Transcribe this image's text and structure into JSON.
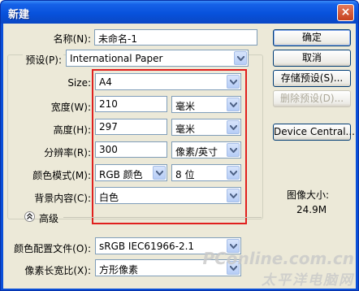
{
  "window": {
    "title": "新建",
    "close_glyph": "×"
  },
  "form": {
    "name_label": "名称(N):",
    "name_value": "未命名-1",
    "preset_label": "预设(P):",
    "preset_value": "International Paper",
    "size_label": "Size:",
    "size_value": "A4",
    "width_label": "宽度(W):",
    "width_value": "210",
    "width_unit": "毫米",
    "height_label": "高度(H):",
    "height_value": "297",
    "height_unit": "毫米",
    "resolution_label": "分辨率(R):",
    "resolution_value": "300",
    "resolution_unit": "像素/英寸",
    "mode_label": "颜色模式(M):",
    "mode_value": "RGB 颜色",
    "bits_value": "8 位",
    "bg_label": "背景内容(C):",
    "bg_value": "白色",
    "advanced_label": "高级",
    "profile_label": "颜色配置文件(O):",
    "profile_value": "sRGB IEC61966-2.1",
    "aspect_label": "像素长宽比(X):",
    "aspect_value": "方形像素"
  },
  "buttons": {
    "ok": "确定",
    "cancel": "取消",
    "save_preset": "存储预设(S)...",
    "delete_preset": "删除预设(D)...",
    "device_central": "Device Central..."
  },
  "info": {
    "image_size_label": "图像大小:",
    "image_size_value": "24.9M"
  },
  "watermark": {
    "line1": "PConline.com.cn",
    "line2": "太平洋电脑网"
  },
  "colors": {
    "title_bar": "#0852dc",
    "highlight_box": "#e0201e",
    "client_bg": "#ece9d8"
  }
}
